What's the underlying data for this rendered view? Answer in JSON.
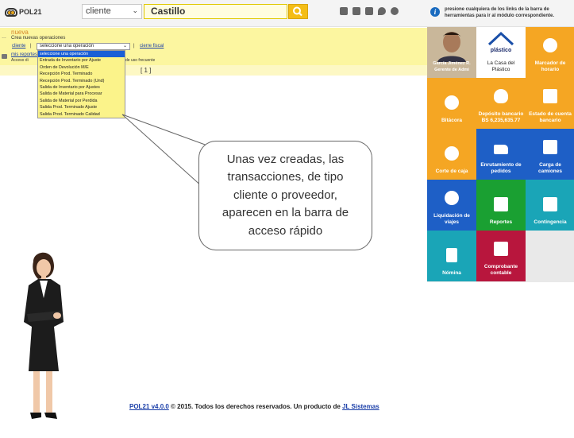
{
  "header": {
    "logo_text": "POL21",
    "search_type": "cliente",
    "search_value": "Castillo",
    "toolbar_icons": [
      "tag-icon",
      "basket-icon",
      "contact-card-icon",
      "map-pin-icon",
      "gear-icon"
    ],
    "info_text": "presione cualquiera de los links de la barra de herramientas para ir al módulo correspondiente."
  },
  "operations": {
    "new_label": "nueva",
    "create_label": "Crea nuevas operaciones",
    "client_link": "cliente",
    "separator": "|",
    "dropdown_selected": "seleccione una operación",
    "close_link": "cierre fiscal",
    "reports_link": "mis reportes",
    "access_text": "Acceso di",
    "frequent_text": "de uso frecuente",
    "page_indicator": "[ 1 ]"
  },
  "dropdown_options": [
    "seleccione una operación",
    "Entrada de Inventario por Ajuste",
    "Orden de Devolución M/E",
    "Recepción Prod. Terminado",
    "Recepción Prod. Terminado (Und)",
    "Salida de Inventario por Ajustes",
    "Salida de Material para Procesar",
    "Salida de Material por Perdida",
    "Salida Prod. Terminado Ajuste",
    "Salida Prod. Terminado Calidad"
  ],
  "callout": {
    "text": "Unas vez creadas, las transacciones, de tipo cliente o proveedor, aparecen en la barra de acceso rápido"
  },
  "footer": {
    "version_link": "POL21 v4.0.0",
    "text": "© 2015. Todos los derechos reservados. Un producto de",
    "company_link": "JL Sistemas"
  },
  "tiles": [
    {
      "label": "García Jiménez R. Gerente de Admi",
      "color": "#c9b79a",
      "icon": "profile-photo"
    },
    {
      "label": "La Casa del Plástico",
      "color": "#ffffff",
      "icon": "house-logo-icon"
    },
    {
      "label": "Marcador de horario",
      "color": "#f5a623",
      "icon": "alarm-clock-icon"
    },
    {
      "label": "Bitácora",
      "color": "#f5a623",
      "icon": "compass-icon"
    },
    {
      "label": "Depósito bancario BS 6,235,635.77",
      "color": "#f5a623",
      "icon": "piggy-bank-icon"
    },
    {
      "label": "Estado de cuenta bancario",
      "color": "#f5a623",
      "icon": "bank-icon"
    },
    {
      "label": "Corte de caja",
      "color": "#f5a623",
      "icon": "dollar-icon"
    },
    {
      "label": "Enrutamiento de pedidos",
      "color": "#1e5fc6",
      "icon": "truck-icon"
    },
    {
      "label": "Carga de camiones",
      "color": "#1e5fc6",
      "icon": "forklift-icon"
    },
    {
      "label": "Liquidación de viajes",
      "color": "#1e5fc6",
      "icon": "globe-lock-icon"
    },
    {
      "label": "Reportes",
      "color": "#1aa032",
      "icon": "printer-icon"
    },
    {
      "label": "Contingencia",
      "color": "#1aa5b7",
      "icon": "contact-folder-icon"
    },
    {
      "label": "Nómina",
      "color": "#1aa5b7",
      "icon": "id-badge-icon"
    },
    {
      "label": "Comprobante contable",
      "color": "#b8163d",
      "icon": "briefcase-icon"
    }
  ]
}
